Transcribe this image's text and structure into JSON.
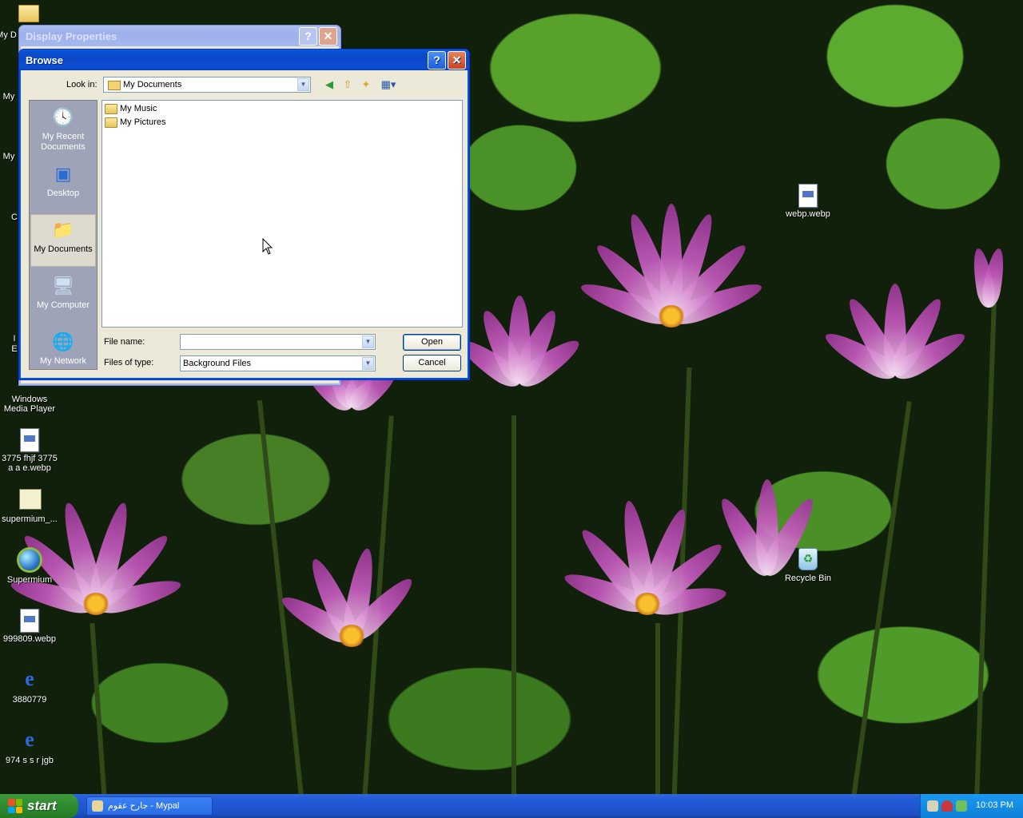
{
  "desktop": {
    "icons": [
      {
        "label": "webp.webp",
        "type": "file"
      },
      {
        "label": "Windows Media Player",
        "type": "media"
      },
      {
        "label": "3775 fhjf 3775 a a e.webp",
        "type": "file"
      },
      {
        "label": "supermium_...",
        "type": "setup"
      },
      {
        "label": "Supermium",
        "type": "globe"
      },
      {
        "label": "999809.webp",
        "type": "file"
      },
      {
        "label": "3880779",
        "type": "ie"
      },
      {
        "label": "974 s s r jgb",
        "type": "ie"
      },
      {
        "label": "Recycle Bin",
        "type": "recycle-bin"
      }
    ],
    "partial_labels": [
      "My D",
      "My",
      "My",
      "C",
      "I",
      "E"
    ]
  },
  "display_properties": {
    "title": "Display Properties",
    "help": "?",
    "close": "✕"
  },
  "browse": {
    "title": "Browse",
    "help": "?",
    "close": "✕",
    "look_in_label": "Look in:",
    "look_in_value": "My Documents",
    "places": [
      {
        "label": "My Recent Documents",
        "icon": "recent-documents-icon",
        "selected": false
      },
      {
        "label": "Desktop",
        "icon": "desktop-icon",
        "selected": false
      },
      {
        "label": "My Documents",
        "icon": "my-documents-icon",
        "selected": true
      },
      {
        "label": "My Computer",
        "icon": "my-computer-icon",
        "selected": false
      },
      {
        "label": "My Network",
        "icon": "my-network-icon",
        "selected": false
      }
    ],
    "files": [
      "My Music",
      "My Pictures"
    ],
    "file_name_label": "File name:",
    "file_name_value": "",
    "files_of_type_label": "Files of type:",
    "files_of_type_value": "Background Files",
    "open_button": "Open",
    "cancel_button": "Cancel"
  },
  "taskbar": {
    "start_label": "start",
    "task_label": "جارح عقوم - Mypal",
    "clock": "10:03 PM"
  },
  "colors": {
    "title_active": "#0a47c8",
    "taskbar": "#245edb",
    "start": "#2f8a2f",
    "tray": "#0f7fd8"
  }
}
